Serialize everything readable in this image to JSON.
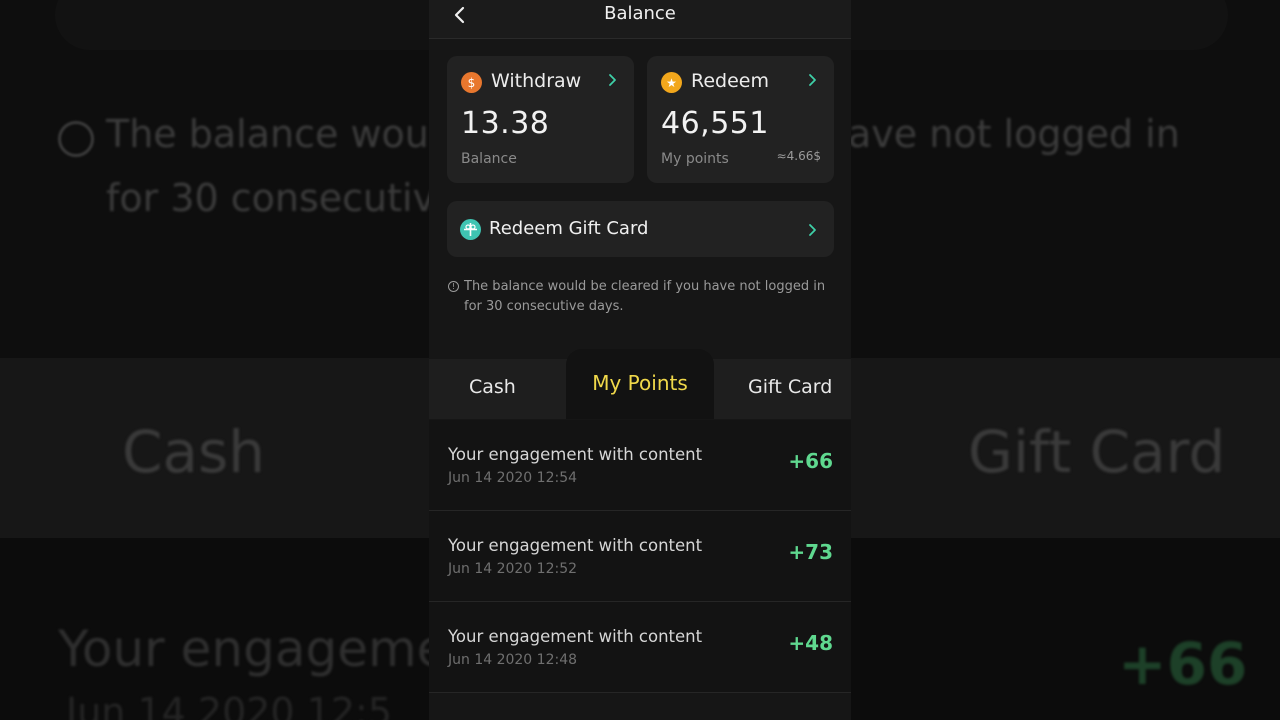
{
  "header": {
    "title": "Balance"
  },
  "withdraw": {
    "label": "Withdraw",
    "value": "13.38",
    "sub_label": "Balance"
  },
  "redeem": {
    "label": "Redeem",
    "value": "46,551",
    "sub_label": "My points",
    "approx": "≈4.66$"
  },
  "gift_card": {
    "label": "Redeem Gift Card"
  },
  "notice": "The balance would be cleared if you have not logged in for 30 consecutive days.",
  "tabs": [
    {
      "label": "Cash",
      "active": false
    },
    {
      "label": "My Points",
      "active": true
    },
    {
      "label": "Gift Card",
      "active": false
    }
  ],
  "transactions": [
    {
      "title": "Your engagement with content",
      "date": "Jun 14 2020 12:54",
      "points": "+66"
    },
    {
      "title": "Your engagement with content",
      "date": "Jun 14 2020 12:52",
      "points": "+73"
    },
    {
      "title": "Your engagement with content",
      "date": "Jun 14 2020 12:48",
      "points": "+48"
    }
  ],
  "background": {
    "notice_line1_a": "The balance wou",
    "notice_line1_b": "ave not logged in",
    "notice_line2": "for 30 consecutiv",
    "tab_cash": "Cash",
    "tab_gift": "Gift Card",
    "row_title": "Your engageme",
    "row_date": "Jun 14 2020 12:5",
    "row_points": "+66"
  },
  "colors": {
    "accent_active_tab": "#f0d84a",
    "points_positive": "#5fd88f",
    "card_bg": "#222222",
    "chevron": "#3fd1a8"
  },
  "icons": {
    "back": "chevron-left-icon",
    "withdraw": "money-bag-icon",
    "redeem": "star-coin-icon",
    "gift": "gift-card-icon",
    "notice": "info-icon",
    "chevron": "chevron-right-icon"
  }
}
